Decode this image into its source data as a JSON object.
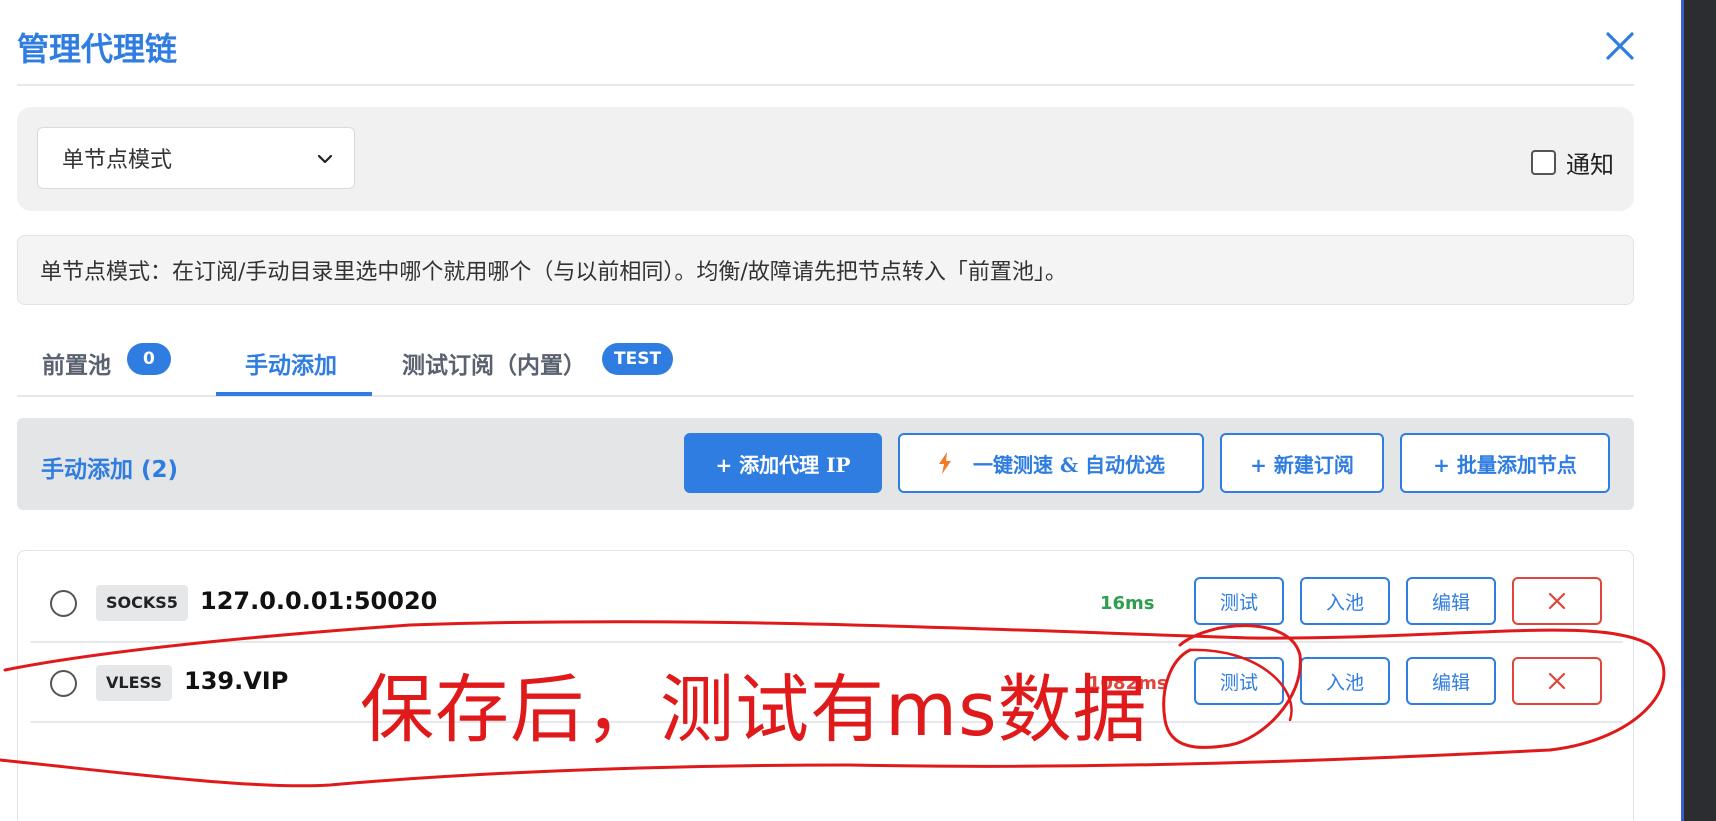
{
  "dialog": {
    "title": "管理代理链"
  },
  "mode": {
    "selected": "单节点模式",
    "notify_label": "通知",
    "notify_checked": false
  },
  "info_text": "单节点模式：在订阅/手动目录里选中哪个就用哪个（与以前相同）。均衡/故障请先把节点转入「前置池」。",
  "tabs": [
    {
      "label": "前置池",
      "badge": "0",
      "active": false
    },
    {
      "label": "手动添加",
      "badge": "",
      "active": true
    },
    {
      "label": "测试订阅（内置）",
      "badge": "TEST",
      "active": false
    }
  ],
  "manual": {
    "title": "手动添加 (2)",
    "buttons": {
      "add_proxy_ip": "+ 添加代理 IP",
      "speed_test": "一键测速 & 自动优选",
      "new_subscription": "+ 新建订阅",
      "batch_add": "+ 批量添加节点"
    }
  },
  "nodes": [
    {
      "protocol": "SOCKS5",
      "address": "127.0.0.01:50020",
      "latency": "16ms",
      "latency_color": "#2e9e4f"
    },
    {
      "protocol": "VLESS",
      "address": "139.VIP",
      "latency": "1082ms",
      "latency_color": "#e0443a"
    }
  ],
  "row_buttons": {
    "test": "测试",
    "pool": "入池",
    "edit": "编辑",
    "delete": "✕"
  },
  "annotation": {
    "text": "保存后，测试有ms数据",
    "color": "#e01a1a"
  },
  "colors": {
    "accent": "#2f7de1",
    "danger": "#e0443a",
    "success": "#2e9e4f"
  }
}
